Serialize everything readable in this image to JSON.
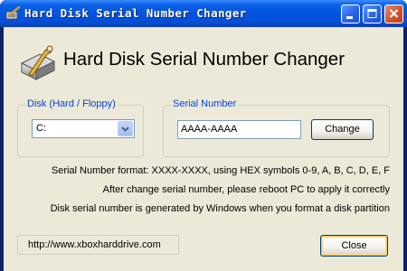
{
  "window": {
    "title": "Hard Disk Serial Number Changer",
    "controls": {
      "minimize": "minimize-icon",
      "maximize": "maximize-icon",
      "close": "close-icon"
    }
  },
  "header": {
    "title": "Hard Disk Serial Number Changer",
    "icon": "hard-disk-wrench-icon"
  },
  "disk_group": {
    "label": "Disk (Hard / Floppy)",
    "selected": "C:"
  },
  "serial_group": {
    "label": "Serial Number",
    "value": "AAAA-AAAA",
    "change_label": "Change"
  },
  "info": {
    "line1": "Serial Number format: XXXX-XXXX, using HEX symbols 0-9, A, B, C, D, E, F",
    "line2": "After change serial number, please reboot PC to apply it correctly",
    "line3": "Disk serial number is generated by Windows when you format a disk partition"
  },
  "footer": {
    "url": "http://www.xboxharddrive.com",
    "close_label": "Close"
  },
  "colors": {
    "titlebar": "#0454df",
    "dialog_bg": "#ece9d8",
    "group_label": "#0046d5",
    "close_button": "#d5512c"
  }
}
